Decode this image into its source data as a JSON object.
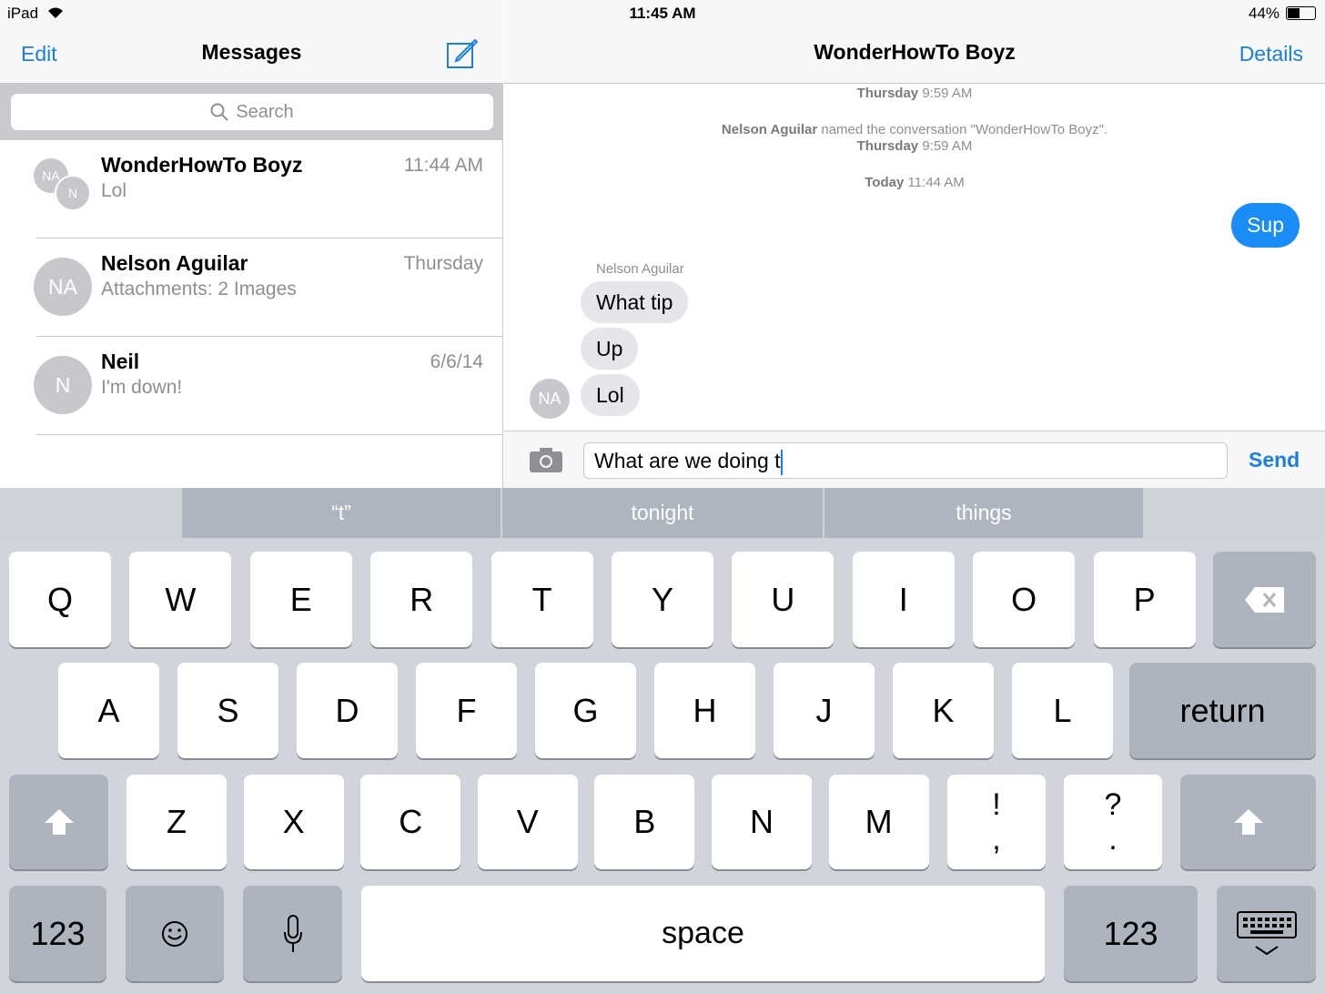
{
  "status": {
    "device": "iPad",
    "time": "11:45 AM",
    "battery": "44%",
    "wifi_icon": "wifi-icon"
  },
  "left": {
    "edit": "Edit",
    "title": "Messages",
    "compose_icon": "compose-icon",
    "search_placeholder": "Search",
    "conversations": [
      {
        "name": "WonderHowTo Boyz",
        "preview": "Lol",
        "time": "11:44 AM",
        "avatars": [
          "NA",
          "N"
        ]
      },
      {
        "name": "Nelson Aguilar",
        "preview": "Attachments: 2 Images",
        "time": "Thursday",
        "avatar": "NA"
      },
      {
        "name": "Neil",
        "preview": "I'm down!",
        "time": "6/6/14",
        "avatar": "N"
      }
    ]
  },
  "right": {
    "title": "WonderHowTo Boyz",
    "details": "Details",
    "sys1_time": {
      "day": "Thursday",
      "time": "9:59 AM"
    },
    "sys2": {
      "who": "Nelson Aguilar",
      "text": "named the conversation \"WonderHowTo Boyz\".",
      "day": "Thursday",
      "time": "9:59 AM"
    },
    "sys3": {
      "day": "Today",
      "time": "11:44 AM"
    },
    "sent": [
      "Sup"
    ],
    "sender": "Nelson Aguilar",
    "sender_avatar": "NA",
    "received": [
      "What tip",
      "Up",
      "Lol"
    ],
    "input_value": "What are we doing t",
    "send": "Send"
  },
  "suggestions": [
    "“t”",
    "tonight",
    "things"
  ],
  "keyboard": {
    "row1": [
      "Q",
      "W",
      "E",
      "R",
      "T",
      "Y",
      "U",
      "I",
      "O",
      "P"
    ],
    "row2": [
      "A",
      "S",
      "D",
      "F",
      "G",
      "H",
      "J",
      "K",
      "L"
    ],
    "row3": [
      "Z",
      "X",
      "C",
      "V",
      "B",
      "N",
      "M"
    ],
    "punct1": {
      "top": "!",
      "bottom": ","
    },
    "punct2": {
      "top": "?",
      "bottom": "."
    },
    "return": "return",
    "space": "space",
    "numbers": "123"
  }
}
